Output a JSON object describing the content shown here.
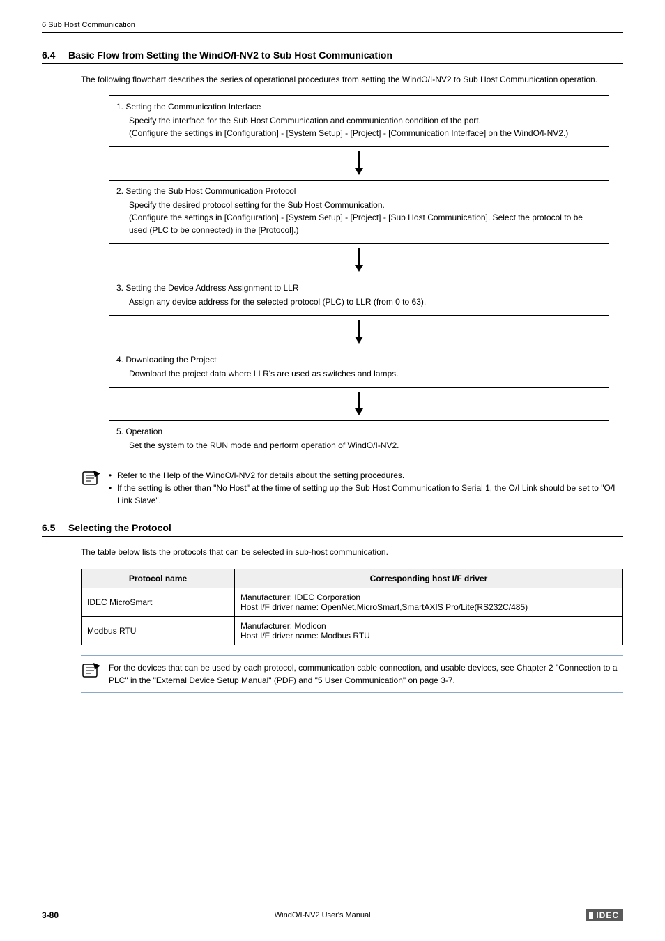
{
  "header": {
    "breadcrumb": "6 Sub Host Communication"
  },
  "section64": {
    "num": "6.4",
    "title": "Basic Flow from Setting the WindO/I-NV2 to Sub Host Communication",
    "intro": "The following flowchart describes the series of operational procedures from setting the WindO/I-NV2 to Sub Host Communication operation.",
    "steps": [
      {
        "title": "1.  Setting the Communication Interface",
        "body": "Specify the interface for the Sub Host Communication and communication condition of the port.\n(Configure the settings in [Configuration] - [System Setup] - [Project] - [Communication Interface] on the WindO/I-NV2.)"
      },
      {
        "title": "2.  Setting the Sub Host Communication Protocol",
        "body": "Specify the desired protocol setting for the Sub Host Communication.\n(Configure the settings in [Configuration] - [System Setup] - [Project] - [Sub Host Communication]. Select the protocol to be used (PLC to be connected) in the [Protocol].)"
      },
      {
        "title": "3.  Setting the Device Address Assignment to LLR",
        "body": "Assign any device address for the selected protocol (PLC) to LLR (from 0 to 63)."
      },
      {
        "title": "4.  Downloading the Project",
        "body": "Download the project data where LLR's are used as switches and lamps."
      },
      {
        "title": "5.  Operation",
        "body": "Set the system to the RUN mode and perform operation of WindO/I-NV2."
      }
    ],
    "notes": [
      "Refer to the Help of the WindO/I-NV2 for details about the setting procedures.",
      "If the setting is other than \"No Host\" at the time of setting up the Sub Host Communication to Serial 1, the O/I Link should be set to \"O/I Link Slave\"."
    ]
  },
  "section65": {
    "num": "6.5",
    "title": "Selecting the Protocol",
    "intro": "The table below lists the protocols that can be selected in sub-host communication.",
    "table": {
      "headers": [
        "Protocol name",
        "Corresponding host I/F driver"
      ],
      "rows": [
        {
          "name": "IDEC MicroSmart",
          "driver": "Manufacturer: IDEC Corporation\nHost I/F driver name: OpenNet,MicroSmart,SmartAXIS Pro/Lite(RS232C/485)"
        },
        {
          "name": "Modbus RTU",
          "driver": "Manufacturer: Modicon\nHost I/F driver name: Modbus RTU"
        }
      ]
    },
    "note": "For the devices that can be used by each protocol, communication cable connection, and usable devices, see Chapter 2 \"Connection to a PLC\" in the \"External Device Setup Manual\" (PDF) and  \"5 User Communication\" on page 3-7."
  },
  "footer": {
    "page": "3-80",
    "center": "WindO/I-NV2 User's Manual",
    "logo": "IDEC"
  }
}
